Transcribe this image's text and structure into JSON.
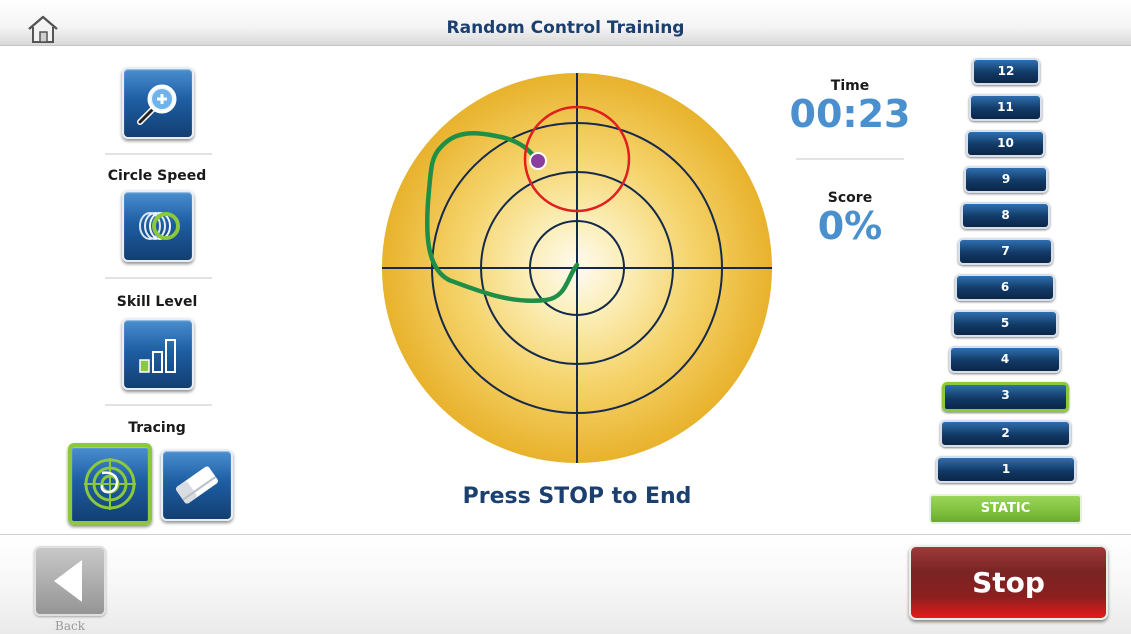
{
  "header": {
    "title": "Random Control Training",
    "home_icon": "home-icon"
  },
  "left_panel": {
    "zoom_icon": "zoom-in-icon",
    "circle_speed": {
      "label": "Circle Speed",
      "icon": "circle-speed-icon"
    },
    "skill_level": {
      "label": "Skill Level",
      "icon": "bar-chart-icon"
    },
    "tracing": {
      "label": "Tracing",
      "trace_icon": "target-trace-icon",
      "eraser_icon": "eraser-icon",
      "trace_selected": true
    }
  },
  "stats": {
    "time_label": "Time",
    "time_value": "00:23",
    "score_label": "Score",
    "score_value": "0%"
  },
  "levels": {
    "items": [
      "12",
      "11",
      "10",
      "9",
      "8",
      "7",
      "6",
      "5",
      "4",
      "3",
      "2",
      "1"
    ],
    "selected": "3",
    "static_label": "STATIC"
  },
  "message": "Press STOP to End",
  "footer": {
    "back_label": "Back",
    "stop_label": "Stop"
  },
  "colors": {
    "title": "#1b3f6e",
    "accent_blue": "#4a90cf",
    "selected_green": "#8bc83c",
    "stop_red": "#8c1f1f",
    "trace_green": "#1f8f47",
    "circle_red": "#e01f1f",
    "marker_purple": "#8a3fa0"
  }
}
